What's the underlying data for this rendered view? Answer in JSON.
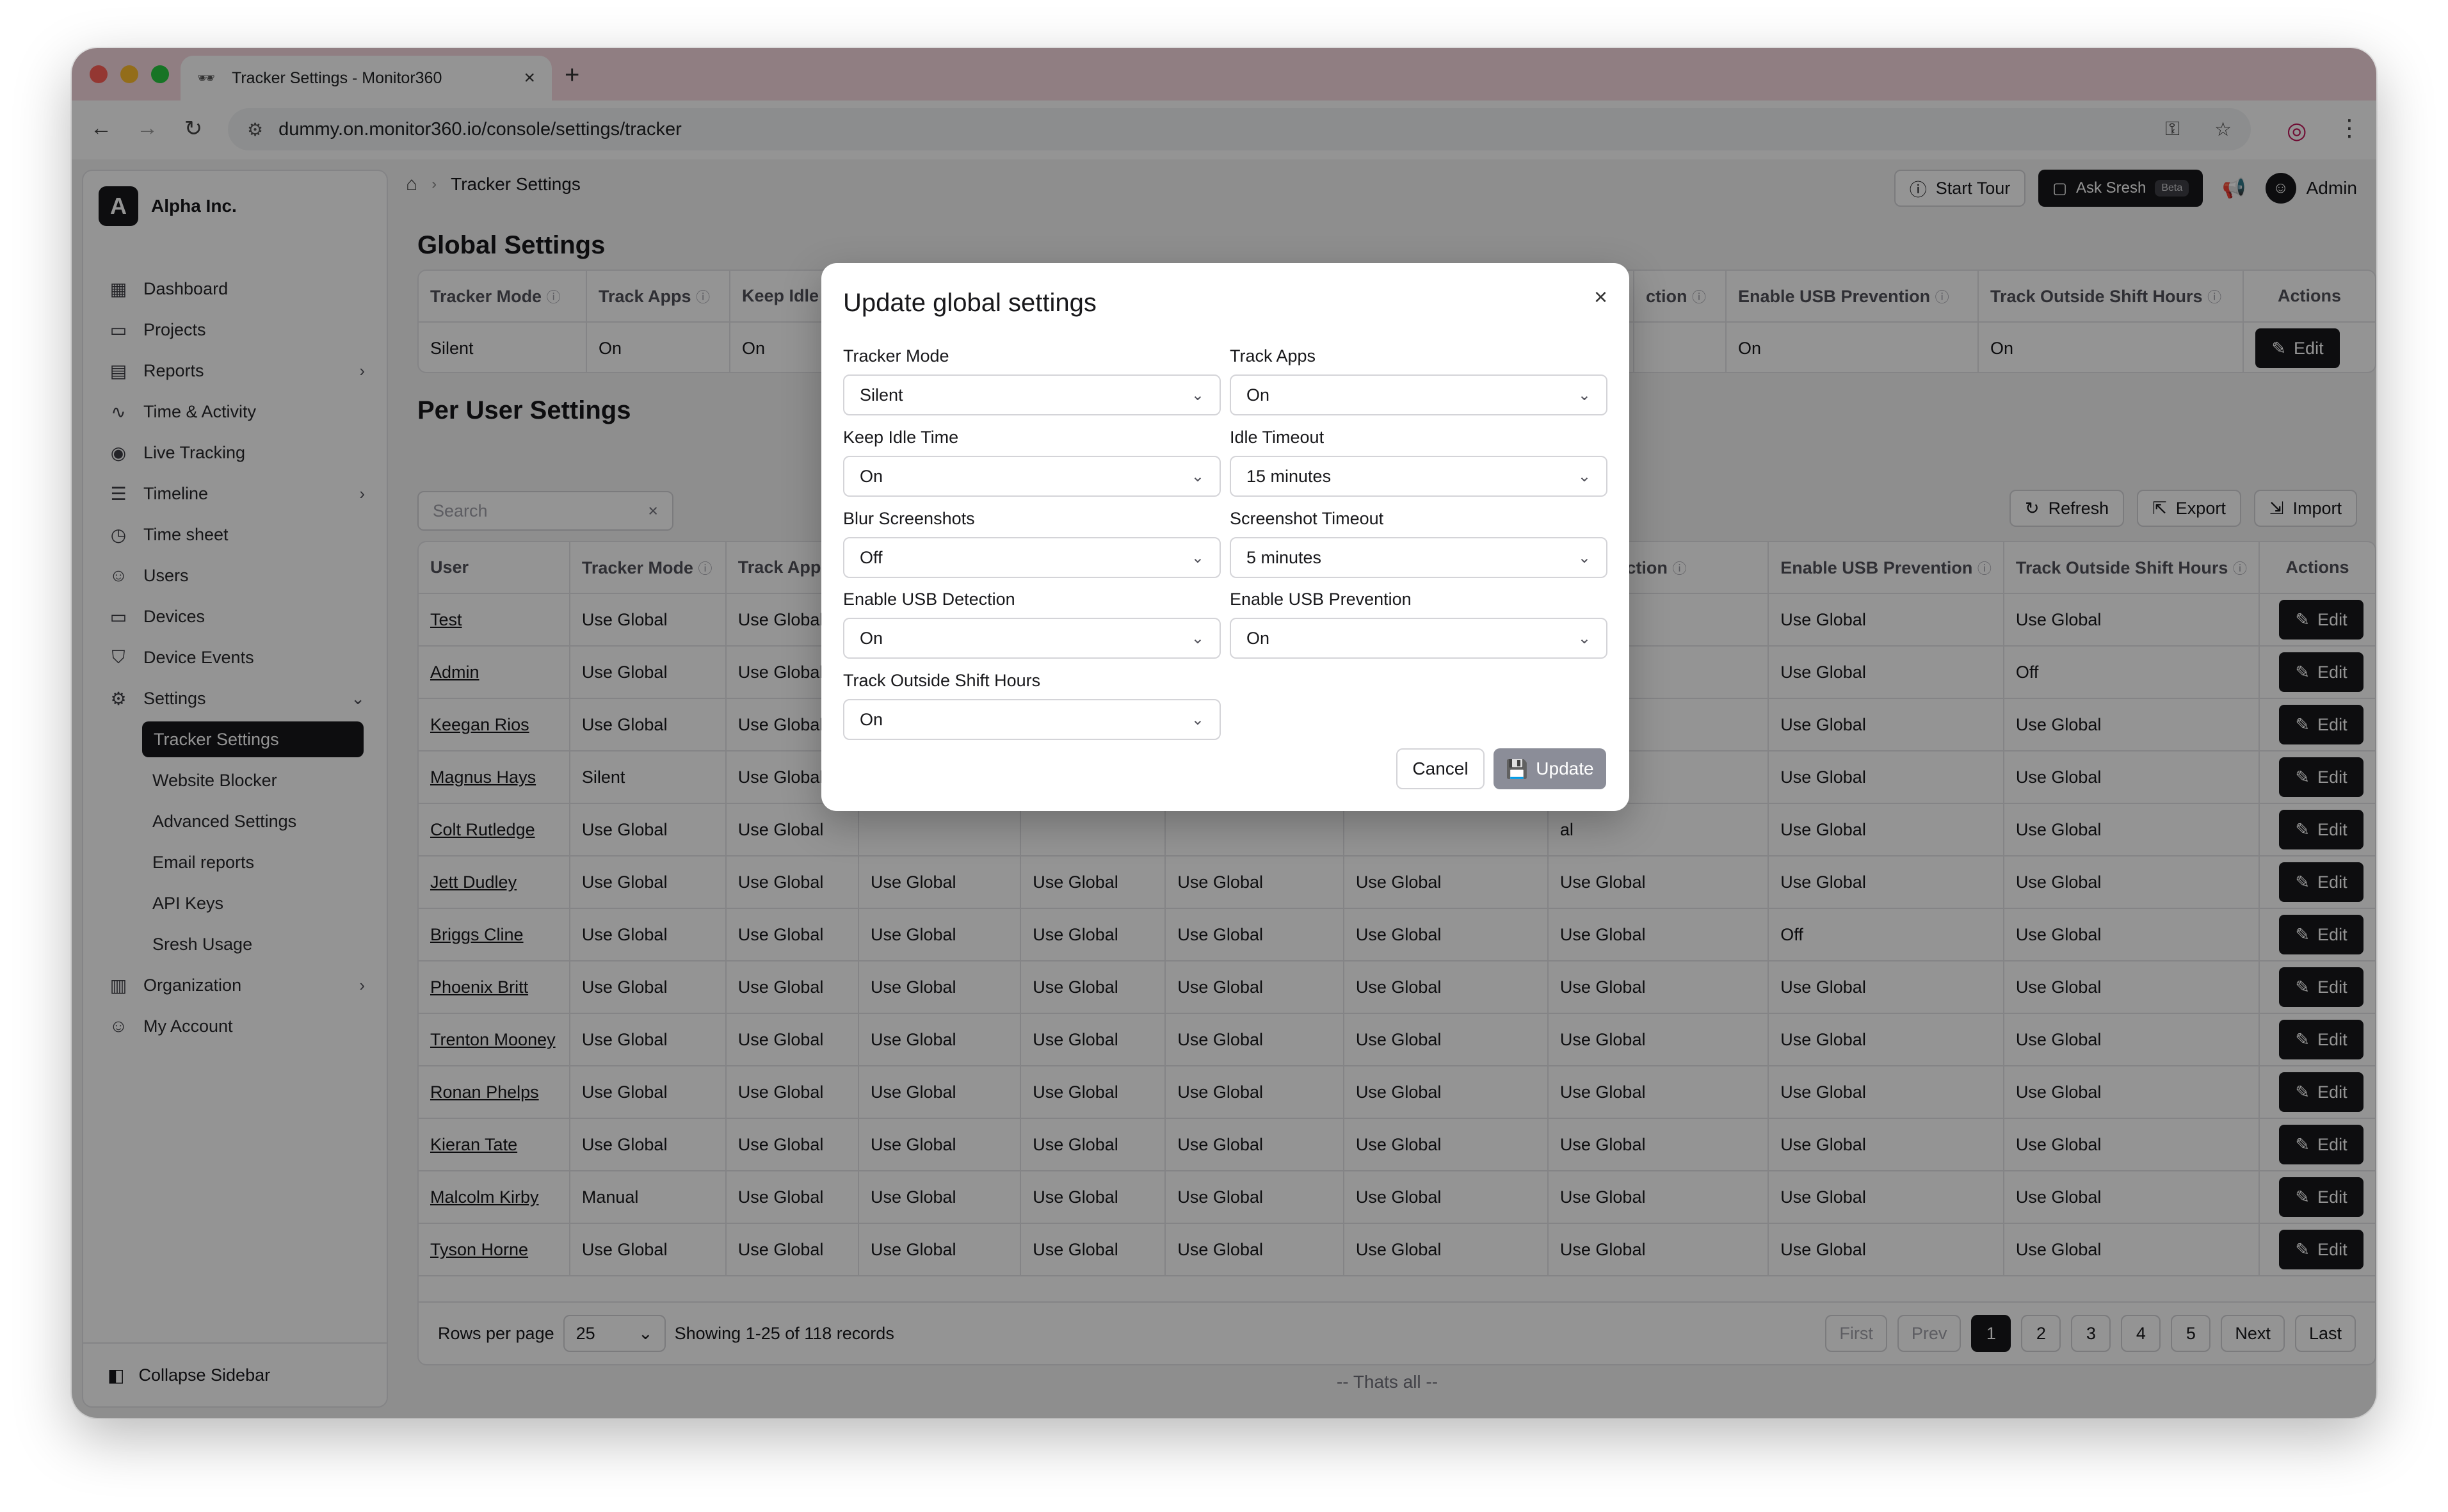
{
  "browser": {
    "tab_title": "Tracker Settings - Monitor360",
    "tab_favicon": "🕶",
    "new_tab": "+",
    "url": "dummy.on.monitor360.io/console/settings/tracker"
  },
  "sidebar": {
    "org_initial": "A",
    "org_name": "Alpha Inc.",
    "items": [
      {
        "label": "Dashboard",
        "icon": "▦"
      },
      {
        "label": "Projects",
        "icon": "▭"
      },
      {
        "label": "Reports",
        "icon": "▤",
        "chevron": "›"
      },
      {
        "label": "Time & Activity",
        "icon": "∿"
      },
      {
        "label": "Live Tracking",
        "icon": "◉"
      },
      {
        "label": "Timeline",
        "icon": "☰",
        "chevron": "›"
      },
      {
        "label": "Time sheet",
        "icon": "◷"
      },
      {
        "label": "Users",
        "icon": "☺"
      },
      {
        "label": "Devices",
        "icon": "▭"
      },
      {
        "label": "Device Events",
        "icon": "⛉"
      },
      {
        "label": "Settings",
        "icon": "⚙",
        "chevron": "⌄"
      }
    ],
    "settings_sub": [
      "Tracker Settings",
      "Website Blocker",
      "Advanced Settings",
      "Email reports",
      "API Keys",
      "Sresh Usage"
    ],
    "bottom_items": [
      {
        "label": "Organization",
        "icon": "▥",
        "chevron": "›"
      },
      {
        "label": "My Account",
        "icon": "☺"
      }
    ],
    "collapse_label": "Collapse Sidebar"
  },
  "header": {
    "breadcrumb": "Tracker Settings",
    "start_tour": "Start Tour",
    "ask_sresh": "Ask Sresh",
    "beta": "Beta",
    "admin": "Admin"
  },
  "global": {
    "title": "Global Settings",
    "headers": [
      "Tracker Mode",
      "Track Apps",
      "Keep Idle T",
      "ction",
      "Enable USB Prevention",
      "Track Outside Shift Hours",
      "Actions"
    ],
    "row": [
      "Silent",
      "On",
      "On",
      "",
      "On",
      "On"
    ],
    "edit": "Edit"
  },
  "per_user": {
    "title": "Per User Settings",
    "search_placeholder": "Search",
    "refresh": "Refresh",
    "export": "Export",
    "import": "Import",
    "headers": [
      "User",
      "Tracker Mode",
      "Track Apps",
      "",
      "",
      "",
      "",
      "SB Detection",
      "Enable USB Prevention",
      "Track Outside Shift Hours",
      "Actions"
    ],
    "rows": [
      [
        "Test",
        "Use Global",
        "Use Global",
        "",
        "",
        "",
        "",
        "al",
        "Use Global",
        "Use Global"
      ],
      [
        "Admin",
        "Use Global",
        "Use Global",
        "",
        "",
        "",
        "",
        "al",
        "Use Global",
        "Off"
      ],
      [
        "Keegan Rios",
        "Use Global",
        "Use Global",
        "",
        "",
        "",
        "",
        "al",
        "Use Global",
        "Use Global"
      ],
      [
        "Magnus Hays",
        "Silent",
        "Use Global",
        "",
        "",
        "",
        "",
        "al",
        "Use Global",
        "Use Global"
      ],
      [
        "Colt Rutledge",
        "Use Global",
        "Use Global",
        "",
        "",
        "",
        "",
        "al",
        "Use Global",
        "Use Global"
      ],
      [
        "Jett Dudley",
        "Use Global",
        "Use Global",
        "Use Global",
        "Use Global",
        "Use Global",
        "Use Global",
        "Use Global",
        "Use Global",
        "Use Global"
      ],
      [
        "Briggs Cline",
        "Use Global",
        "Use Global",
        "Use Global",
        "Use Global",
        "Use Global",
        "Use Global",
        "Use Global",
        "Off",
        "Use Global"
      ],
      [
        "Phoenix Britt",
        "Use Global",
        "Use Global",
        "Use Global",
        "Use Global",
        "Use Global",
        "Use Global",
        "Use Global",
        "Use Global",
        "Use Global"
      ],
      [
        "Trenton Mooney",
        "Use Global",
        "Use Global",
        "Use Global",
        "Use Global",
        "Use Global",
        "Use Global",
        "Use Global",
        "Use Global",
        "Use Global"
      ],
      [
        "Ronan Phelps",
        "Use Global",
        "Use Global",
        "Use Global",
        "Use Global",
        "Use Global",
        "Use Global",
        "Use Global",
        "Use Global",
        "Use Global"
      ],
      [
        "Kieran Tate",
        "Use Global",
        "Use Global",
        "Use Global",
        "Use Global",
        "Use Global",
        "Use Global",
        "Use Global",
        "Use Global",
        "Use Global"
      ],
      [
        "Malcolm Kirby",
        "Manual",
        "Use Global",
        "Use Global",
        "Use Global",
        "Use Global",
        "Use Global",
        "Use Global",
        "Use Global",
        "Use Global"
      ],
      [
        "Tyson Horne",
        "Use Global",
        "Use Global",
        "Use Global",
        "Use Global",
        "Use Global",
        "Use Global",
        "Use Global",
        "Use Global",
        "Use Global"
      ]
    ],
    "edit": "Edit"
  },
  "pager": {
    "rows_per_page_label": "Rows per page",
    "rows_per_page": "25",
    "showing": "Showing 1-25 of 118 records",
    "first": "First",
    "prev": "Prev",
    "pages": [
      "1",
      "2",
      "3",
      "4",
      "5"
    ],
    "next": "Next",
    "last": "Last",
    "thats_all": "-- Thats all --"
  },
  "modal": {
    "title": "Update global settings",
    "fields": [
      {
        "label": "Tracker Mode",
        "value": "Silent"
      },
      {
        "label": "Track Apps",
        "value": "On"
      },
      {
        "label": "Keep Idle Time",
        "value": "On"
      },
      {
        "label": "Idle Timeout",
        "value": "15 minutes"
      },
      {
        "label": "Blur Screenshots",
        "value": "Off"
      },
      {
        "label": "Screenshot Timeout",
        "value": "5 minutes"
      },
      {
        "label": "Enable USB Detection",
        "value": "On"
      },
      {
        "label": "Enable USB Prevention",
        "value": "On"
      },
      {
        "label": "Track Outside Shift Hours",
        "value": "On"
      }
    ],
    "cancel": "Cancel",
    "update": "Update"
  },
  "colors": {
    "tabbar": "#f9d9e0",
    "primary": "#18181b",
    "update_disabled": "#8b8d98"
  }
}
